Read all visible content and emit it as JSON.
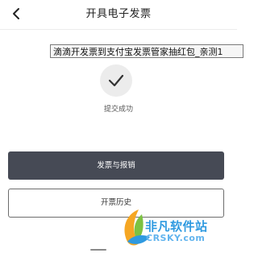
{
  "header": {
    "back_icon": "chevron-left-icon",
    "title": "开具电子发票"
  },
  "banner_text": "滴滴开发票到支付宝发票管家抽红包_亲测1",
  "status": {
    "icon": "checkmark-icon",
    "text": "提交成功"
  },
  "actions": {
    "primary_label": "发票与报销",
    "secondary_label": "开票历史"
  },
  "watermark": {
    "text": "非凡软件站",
    "sub": "CRSKY.com"
  },
  "colors": {
    "primary_button": "#464a55",
    "success_circle": "#ececec",
    "watermark_blue": "#2f9ae0"
  }
}
